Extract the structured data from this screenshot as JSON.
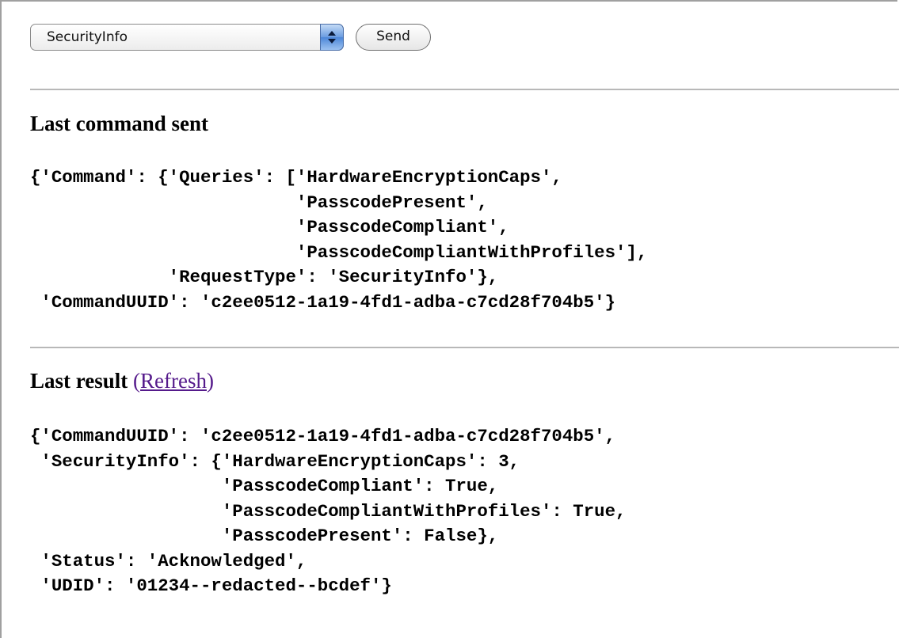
{
  "toolbar": {
    "select_value": "SecurityInfo",
    "send_label": "Send"
  },
  "command_section": {
    "heading": "Last command sent",
    "lines": [
      "{'Command': {'Queries': ['HardwareEncryptionCaps',",
      "                         'PasscodePresent',",
      "                         'PasscodeCompliant',",
      "                         'PasscodeCompliantWithProfiles'],",
      "             'RequestType': 'SecurityInfo'},",
      " 'CommandUUID': 'c2ee0512-1a19-4fd1-adba-c7cd28f704b5'}"
    ]
  },
  "result_section": {
    "heading": "Last result",
    "open_paren": "(",
    "refresh_label": "Refresh",
    "close_paren": ")",
    "lines": [
      "{'CommandUUID': 'c2ee0512-1a19-4fd1-adba-c7cd28f704b5',",
      " 'SecurityInfo': {'HardwareEncryptionCaps': 3,",
      "                  'PasscodeCompliant': True,",
      "                  'PasscodeCompliantWithProfiles': True,",
      "                  'PasscodePresent': False},",
      " 'Status': 'Acknowledged',",
      " 'UDID': '01234--redacted--bcdef'}"
    ]
  }
}
